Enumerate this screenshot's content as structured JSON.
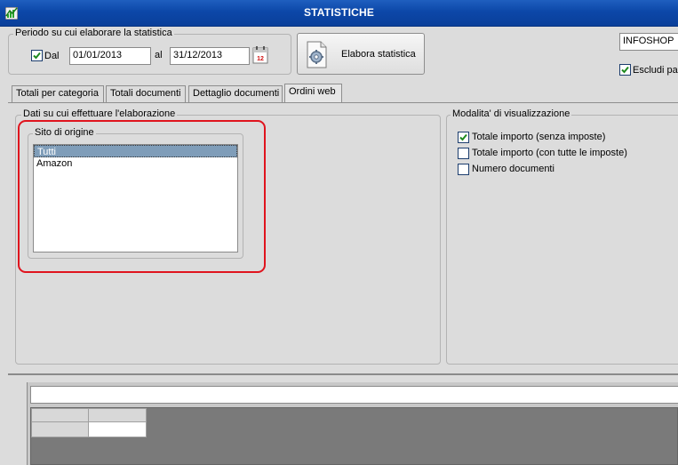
{
  "window": {
    "title": "STATISTICHE",
    "icon": "chart-app-icon"
  },
  "period": {
    "legend": "Periodo su cui elaborare la statistica",
    "from_label": "Dal",
    "from_checked": true,
    "from_value": "01/01/2013",
    "to_label": "al",
    "to_value": "31/12/2013",
    "calendar_icon": "calendar-icon"
  },
  "elabora_button": {
    "label": "Elabora statistica",
    "icon": "gear-document-icon"
  },
  "shop": {
    "value": "INFOSHOP"
  },
  "escludi": {
    "label": "Escludi pas",
    "checked": true
  },
  "tabs": [
    {
      "label": "Totali per categoria",
      "active": false
    },
    {
      "label": "Totali documenti",
      "active": false
    },
    {
      "label": "Dettaglio documenti",
      "active": false
    },
    {
      "label": "Ordini web",
      "active": true
    }
  ],
  "data_panel": {
    "legend": "Dati su cui effettuare l'elaborazione",
    "sito": {
      "legend": "Sito di origine",
      "items": [
        {
          "label": "Tutti",
          "selected": true
        },
        {
          "label": "Amazon",
          "selected": false
        }
      ]
    }
  },
  "modalita": {
    "legend": "Modalita' di visualizzazione",
    "options": [
      {
        "label": "Totale importo (senza imposte)",
        "checked": true
      },
      {
        "label": "Totale importo (con tutte le imposte)",
        "checked": false
      },
      {
        "label": "Numero documenti",
        "checked": false
      }
    ]
  },
  "colors": {
    "titlebar": "#0c47a8",
    "selection": "#7f9db9",
    "highlight": "#e0141e",
    "grid_bg": "#7a7a7a"
  }
}
